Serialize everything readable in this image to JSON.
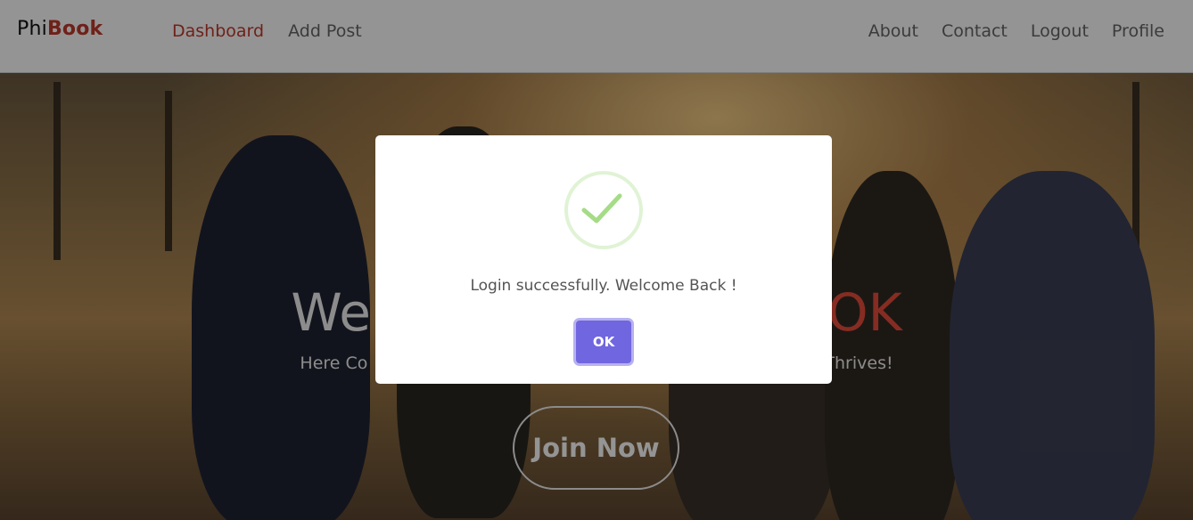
{
  "navbar": {
    "brand_phi": "Phi",
    "brand_book": "Book",
    "left_links": [
      {
        "label": "Dashboard",
        "active": true
      },
      {
        "label": "Add Post",
        "active": false
      }
    ],
    "right_links": [
      {
        "label": "About"
      },
      {
        "label": "Contact"
      },
      {
        "label": "Logout"
      },
      {
        "label": "Profile"
      }
    ]
  },
  "hero": {
    "title_start": "We",
    "title_end": "OK",
    "subtitle_start": "Here Co",
    "subtitle_end": "Thrives!",
    "join_label": "Join Now"
  },
  "modal": {
    "icon": "success-check-icon",
    "message": "Login successfully. Welcome Back !",
    "ok_label": "OK"
  },
  "colors": {
    "brand_accent": "#c0392b",
    "modal_button": "#7066e0",
    "success_check": "#a5dc86"
  }
}
